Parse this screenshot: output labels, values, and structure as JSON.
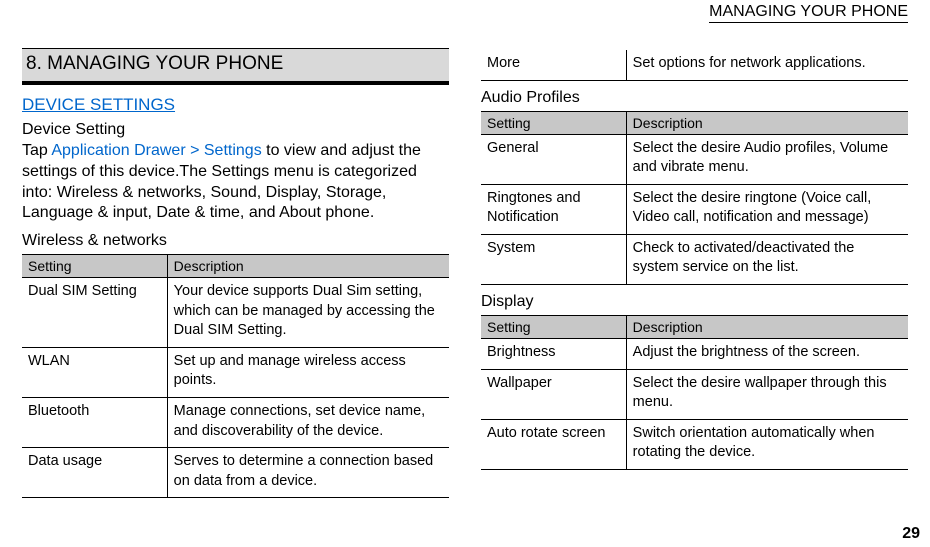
{
  "header": {
    "running_title": "MANAGING YOUR PHONE"
  },
  "chapter": {
    "title": "8. MANAGING YOUR PHONE"
  },
  "section": {
    "heading": "DEVICE SETTINGS",
    "sub_heading": "Device Setting",
    "body_before_link": "Tap ",
    "body_link": "Application Drawer > Settings",
    "body_after_link": " to view and adjust the settings of this device.The Settings menu is categorized into: Wireless & networks, Sound, Display, Storage, Language & input, Date & time, and About phone."
  },
  "wireless": {
    "heading": "Wireless & networks",
    "th_setting": "Setting",
    "th_desc": "Description",
    "rows": [
      {
        "setting": "Dual SIM Setting",
        "desc": "Your device supports Dual Sim setting, which can be managed by accessing the Dual SIM Setting."
      },
      {
        "setting": "WLAN",
        "desc": "Set up and manage wireless access points."
      },
      {
        "setting": "Bluetooth",
        "desc": "Manage connections, set device name, and discoverability of the device."
      },
      {
        "setting": "Data usage",
        "desc": "Serves to determine a connection based on data from a device."
      }
    ]
  },
  "more_row": {
    "setting": "More",
    "desc": "Set options for network applications."
  },
  "audio": {
    "heading": "Audio Profiles",
    "th_setting": "Setting",
    "th_desc": "Description",
    "rows": [
      {
        "setting": "General",
        "desc": "Select the desire Audio profiles, Volume and vibrate menu."
      },
      {
        "setting": "Ringtones and Notification",
        "desc": "Select the desire ringtone (Voice call, Video call, notification and message)"
      },
      {
        "setting": "System",
        "desc": "Check to activated/deactivated the system service on the list."
      }
    ]
  },
  "display": {
    "heading": "Display",
    "th_setting": "Setting",
    "th_desc": "Description",
    "rows": [
      {
        "setting": "Brightness",
        "desc": "Adjust the brightness of the screen."
      },
      {
        "setting": "Wallpaper",
        "desc": "Select the desire wallpaper through this menu."
      },
      {
        "setting": "Auto rotate screen",
        "desc": "Switch orientation automatically when rotating the device."
      }
    ]
  },
  "page_number": "29"
}
